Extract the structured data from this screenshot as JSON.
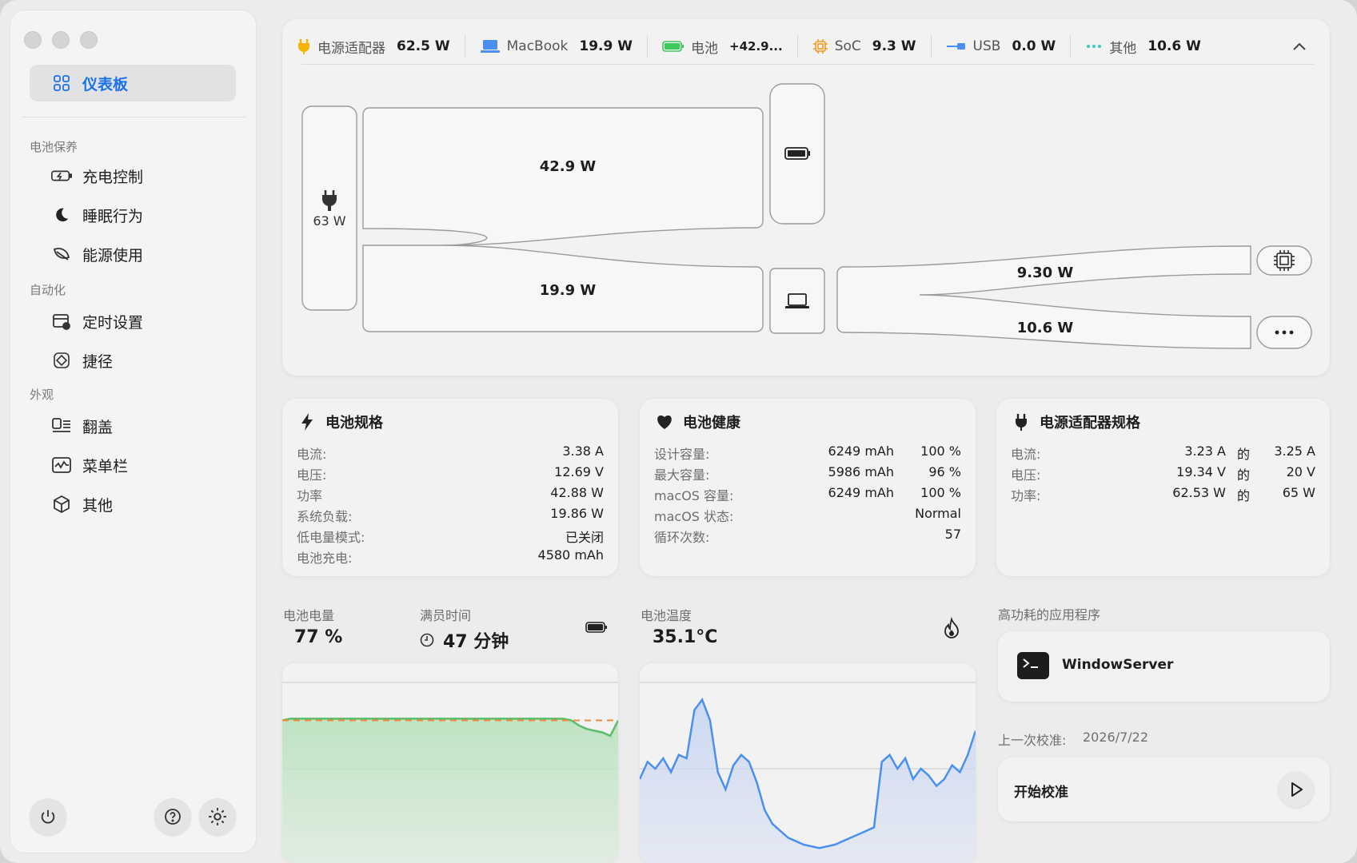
{
  "sidebar": {
    "active": {
      "label": "仪表板",
      "icon": "dashboard-icon"
    },
    "sections": [
      {
        "title": "电池保养",
        "items": [
          {
            "label": "充电控制",
            "icon": "charging-battery-icon"
          },
          {
            "label": "睡眠行为",
            "icon": "moon-icon"
          },
          {
            "label": "能源使用",
            "icon": "leaf-icon"
          }
        ]
      },
      {
        "title": "自动化",
        "items": [
          {
            "label": "定时设置",
            "icon": "calendar-clock-icon"
          },
          {
            "label": "捷径",
            "icon": "shortcuts-icon"
          }
        ]
      },
      {
        "title": "外观",
        "items": [
          {
            "label": "翻盖",
            "icon": "lid-icon"
          },
          {
            "label": "菜单栏",
            "icon": "menubar-icon"
          },
          {
            "label": "其他",
            "icon": "cube-icon"
          }
        ]
      }
    ]
  },
  "topbar": [
    {
      "label": "电源适配器",
      "value": "62.5 W",
      "icon": "plug-icon",
      "color": "#f5b400"
    },
    {
      "label": "MacBook",
      "value": "19.9 W",
      "icon": "laptop-icon",
      "color": "#4a8ef0"
    },
    {
      "label": "电池",
      "value": "+42.9...",
      "icon": "battery-icon",
      "color": "#3cc85a"
    },
    {
      "label": "SoC",
      "value": "9.3 W",
      "icon": "chip-icon",
      "color": "#f39a1e"
    },
    {
      "label": "USB",
      "value": "0.0 W",
      "icon": "usb-icon",
      "color": "#4a8ef0"
    },
    {
      "label": "其他",
      "value": "10.6 W",
      "icon": "dots-icon",
      "color": "#3cc8c8"
    }
  ],
  "sankey": {
    "source": "63 W",
    "battery_flow": "42.9 W",
    "macbook_flow": "19.9 W",
    "soc_flow": "9.30 W",
    "other_flow": "10.6 W"
  },
  "battery_spec": {
    "title": "电池规格",
    "rows": [
      {
        "k": "电流:",
        "v": "3.38 A"
      },
      {
        "k": "电压:",
        "v": "12.69 V"
      },
      {
        "k": "功率",
        "v": "42.88 W"
      },
      {
        "k": "系统负载:",
        "v": "19.86 W"
      },
      {
        "k": "低电量模式:",
        "v": "已关闭"
      },
      {
        "k": "电池充电:",
        "v": "4580 mAh"
      }
    ]
  },
  "battery_health": {
    "title": "电池健康",
    "rows": [
      {
        "k": "设计容量:",
        "v": "6249 mAh",
        "p": "100 %"
      },
      {
        "k": "最大容量:",
        "v": "5986 mAh",
        "p": "96 %"
      },
      {
        "k": "macOS 容量:",
        "v": "6249 mAh",
        "p": "100 %"
      },
      {
        "k": "macOS 状态:",
        "v": "Normal",
        "p": ""
      },
      {
        "k": "循环次数:",
        "v": "57",
        "p": ""
      }
    ]
  },
  "adapter_spec": {
    "title": "电源适配器规格",
    "rows": [
      {
        "k": "电流:",
        "v": "3.23 A",
        "of": "的",
        "max": "3.25 A"
      },
      {
        "k": "电压:",
        "v": "19.34 V",
        "of": "的",
        "max": "20 V"
      },
      {
        "k": "功率:",
        "v": "62.53 W",
        "of": "的",
        "max": "65 W"
      }
    ]
  },
  "stats": {
    "level_label": "电池电量",
    "level_value": "77 %",
    "full_label": "满员时间",
    "full_value": "47 分钟",
    "temp_label": "电池温度",
    "temp_value": "35.1°C"
  },
  "apps": {
    "title": "高功耗的应用程序",
    "app_name": "WindowServer",
    "calib_label": "上一次校准:",
    "calib_date": "2026/7/22",
    "calib_button": "开始校准"
  },
  "chart_data": [
    {
      "type": "area",
      "series": [
        {
          "values": [
            78,
            79,
            79,
            79,
            79,
            79,
            79,
            79,
            79,
            79,
            79,
            79,
            79,
            79,
            79,
            79,
            79,
            79,
            79,
            79,
            79,
            79,
            79,
            79,
            79,
            79,
            79,
            79,
            79,
            79,
            79,
            79,
            79,
            79,
            79,
            79,
            79,
            78,
            75,
            73,
            72,
            71,
            69,
            78
          ]
        }
      ],
      "reference_line": 78,
      "colors": {
        "fill": "#bfe3c2",
        "line": "#5bbd6a",
        "ref": "#f08a3c"
      }
    },
    {
      "type": "area",
      "series": [
        {
          "values": [
            35.2,
            35.7,
            35.5,
            35.8,
            35.4,
            35.9,
            35.8,
            37.2,
            37.5,
            36.9,
            35.4,
            34.9,
            35.6,
            35.9,
            35.7,
            35.1,
            34.3,
            33.9,
            33.7,
            33.5,
            33.4,
            33.3,
            33.25,
            33.2,
            33.25,
            33.3,
            33.4,
            33.5,
            33.6,
            33.7,
            33.8,
            35.7,
            35.9,
            35.5,
            35.8,
            35.2,
            35.5,
            35.3,
            35.0,
            35.2,
            35.6,
            35.4,
            35.9,
            36.6
          ]
        }
      ],
      "colors": {
        "fill": "#cdd9f2",
        "line": "#4a90f0"
      }
    }
  ]
}
